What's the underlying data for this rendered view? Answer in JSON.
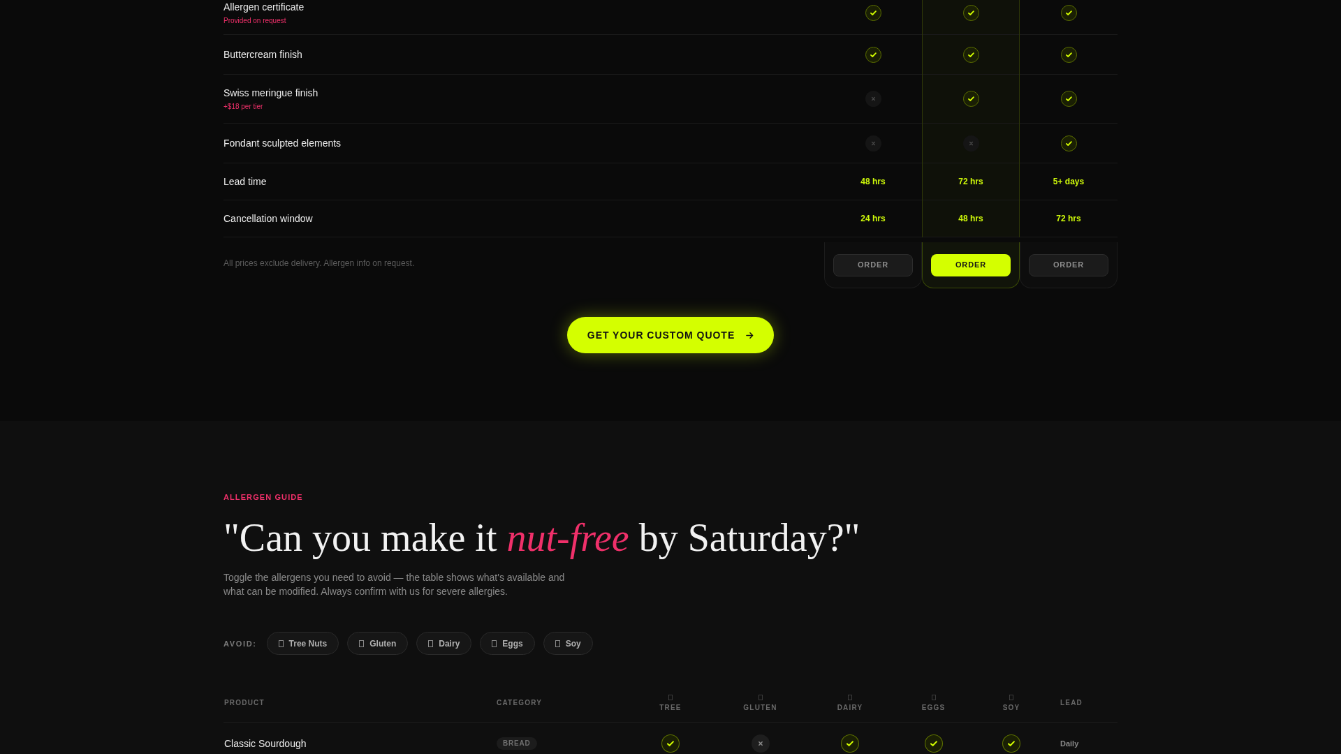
{
  "comparison": {
    "plans": [
      {
        "featured": false,
        "order_button": "ORDER"
      },
      {
        "featured": true,
        "order_button": "ORDER"
      },
      {
        "featured": false,
        "order_button": "ORDER"
      }
    ],
    "rows": [
      {
        "kind": "feature",
        "label": "Allergen certificate",
        "note": "Provided on request",
        "included": [
          true,
          true,
          true
        ]
      },
      {
        "kind": "feature",
        "label": "Buttercream finish",
        "included": [
          true,
          true,
          true
        ]
      },
      {
        "kind": "feature",
        "label": "Swiss meringue finish",
        "note": "+$18 per tier",
        "included": [
          false,
          true,
          true
        ]
      },
      {
        "kind": "feature",
        "label": "Fondant sculpted elements",
        "included": [
          false,
          false,
          true
        ]
      },
      {
        "kind": "value",
        "label": "Lead time",
        "values": [
          "48 hrs",
          "72 hrs",
          "5+ days"
        ]
      },
      {
        "kind": "value",
        "label": "Cancellation window",
        "values": [
          "24 hrs",
          "48 hrs",
          "72 hrs"
        ]
      }
    ],
    "footnote": "All prices exclude delivery. Allergen info on request."
  },
  "cta": {
    "label": "GET YOUR CUSTOM QUOTE"
  },
  "allergen_guide": {
    "eyebrow": "ALLERGEN GUIDE",
    "heading": "\"Can you make it *nut-free* by Saturday?\"",
    "description": "Toggle the allergens you need to avoid — the table shows what's available and what can be modified. Always confirm with us for severe allergies.",
    "filter": {
      "label": "AVOID:",
      "options": [
        {
          "label": "Tree Nuts",
          "selected": false
        },
        {
          "label": "Gluten",
          "selected": false
        },
        {
          "label": "Dairy",
          "selected": false
        },
        {
          "label": "Eggs",
          "selected": false
        },
        {
          "label": "Soy",
          "selected": false
        }
      ]
    },
    "table": {
      "columns": [
        {
          "kind": "product",
          "label": "PRODUCT"
        },
        {
          "kind": "category",
          "label": "CATEGORY"
        },
        {
          "kind": "allergen",
          "label": "TREE"
        },
        {
          "kind": "allergen",
          "label": "GLUTEN"
        },
        {
          "kind": "allergen",
          "label": "DAIRY"
        },
        {
          "kind": "allergen",
          "label": "EGGS"
        },
        {
          "kind": "allergen",
          "label": "SOY"
        },
        {
          "kind": "lead",
          "label": "LEAD"
        }
      ],
      "rows": [
        {
          "product": "Classic Sourdough",
          "category": "BREAD",
          "allergens": [
            {
              "available": true
            },
            {
              "available": false
            },
            {
              "available": true
            },
            {
              "available": true
            },
            {
              "available": true
            }
          ],
          "lead": "Daily"
        }
      ]
    }
  }
}
